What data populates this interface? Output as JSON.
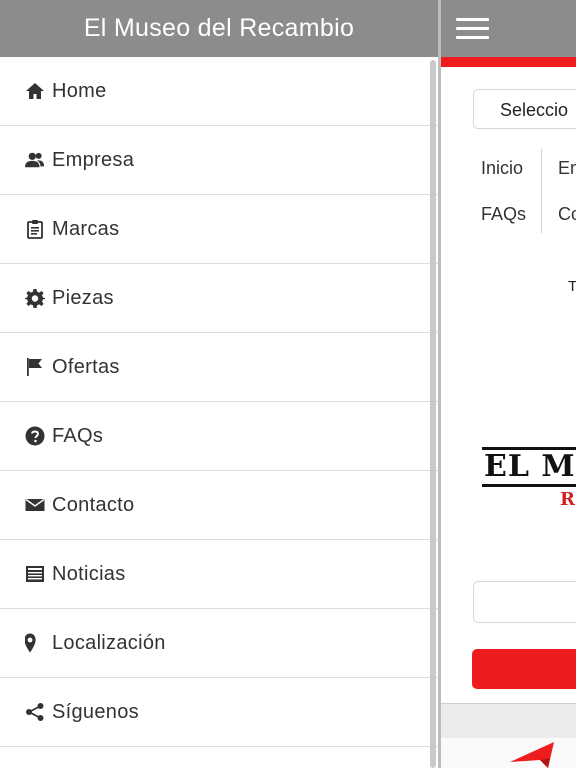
{
  "drawer": {
    "title": "El Museo del Recambio",
    "items": [
      {
        "label": "Home",
        "icon": "home-icon"
      },
      {
        "label": "Empresa",
        "icon": "users-icon"
      },
      {
        "label": "Marcas",
        "icon": "clipboard-icon"
      },
      {
        "label": "Piezas",
        "icon": "gear-icon"
      },
      {
        "label": "Ofertas",
        "icon": "flag-icon"
      },
      {
        "label": "FAQs",
        "icon": "question-circle-icon"
      },
      {
        "label": "Contacto",
        "icon": "envelope-icon"
      },
      {
        "label": "Noticias",
        "icon": "newspaper-icon"
      },
      {
        "label": "Localización",
        "icon": "map-marker-icon"
      },
      {
        "label": "Síguenos",
        "icon": "share-icon"
      }
    ]
  },
  "main": {
    "select_text": "Seleccio",
    "nav": {
      "row1": {
        "a": "Inicio",
        "b": "Em"
      },
      "row2": {
        "a": "FAQs",
        "b": "Co"
      }
    },
    "fragment_text": "T",
    "logo": {
      "main": "EL MU",
      "sub": "R"
    }
  },
  "colors": {
    "header_bg": "#8c8c8c",
    "accent_red": "#ee1c1c",
    "text": "#333333"
  }
}
